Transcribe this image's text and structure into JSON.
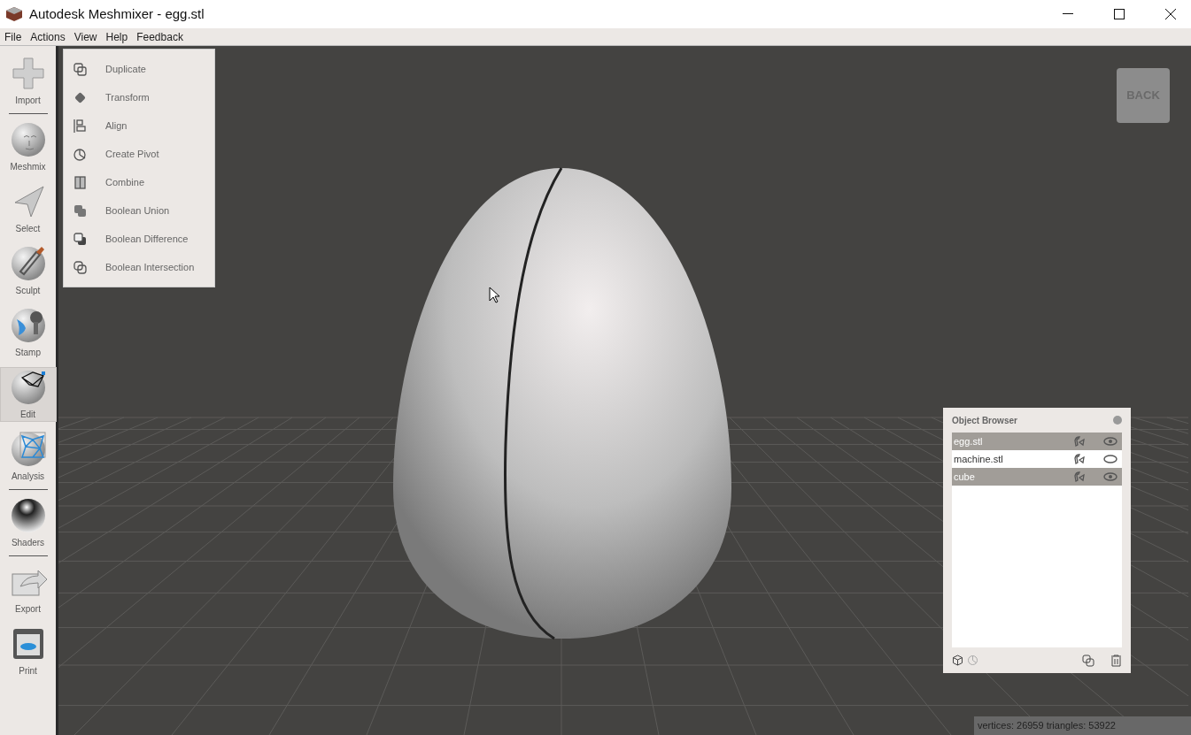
{
  "window": {
    "title": "Autodesk Meshmixer - egg.stl"
  },
  "menu_bar": [
    "File",
    "Actions",
    "View",
    "Help",
    "Feedback"
  ],
  "toolbar": [
    {
      "label": "Import",
      "kind": "import",
      "selected": false,
      "separator_after": true
    },
    {
      "label": "Meshmix",
      "kind": "meshmix",
      "selected": false,
      "separator_after": false
    },
    {
      "label": "Select",
      "kind": "select",
      "selected": false,
      "separator_after": false
    },
    {
      "label": "Sculpt",
      "kind": "sculpt",
      "selected": false,
      "separator_after": false
    },
    {
      "label": "Stamp",
      "kind": "stamp",
      "selected": false,
      "separator_after": false
    },
    {
      "label": "Edit",
      "kind": "edit",
      "selected": true,
      "separator_after": false
    },
    {
      "label": "Analysis",
      "kind": "analysis",
      "selected": false,
      "separator_after": true
    },
    {
      "label": "Shaders",
      "kind": "shaders",
      "selected": false,
      "separator_after": true
    },
    {
      "label": "Export",
      "kind": "export",
      "selected": false,
      "separator_after": false
    },
    {
      "label": "Print",
      "kind": "print",
      "selected": false,
      "separator_after": false
    }
  ],
  "edit_menu": [
    {
      "label": "Duplicate",
      "kind": "duplicate"
    },
    {
      "label": "Transform",
      "kind": "transform"
    },
    {
      "label": "Align",
      "kind": "align"
    },
    {
      "label": "Create Pivot",
      "kind": "pivot"
    },
    {
      "label": "Combine",
      "kind": "combine"
    },
    {
      "label": "Boolean Union",
      "kind": "union"
    },
    {
      "label": "Boolean Difference",
      "kind": "difference"
    },
    {
      "label": "Boolean Intersection",
      "kind": "intersection"
    }
  ],
  "view_cube": {
    "label": "BACK"
  },
  "object_browser": {
    "title": "Object Browser",
    "objects": [
      {
        "name": "egg.stl",
        "selected": true,
        "visible": true
      },
      {
        "name": "machine.stl",
        "selected": false,
        "visible": false
      },
      {
        "name": "cube",
        "selected": true,
        "visible": true
      }
    ]
  },
  "status_bar": "vertices: 26959 triangles: 53922"
}
